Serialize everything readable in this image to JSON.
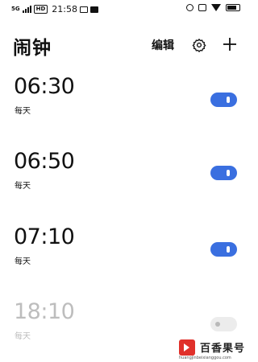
{
  "status_bar": {
    "network": "5G",
    "time": "21:58"
  },
  "header": {
    "title": "闹钟",
    "edit_label": "编辑",
    "settings_icon": "gear-icon",
    "add_icon": "plus-icon"
  },
  "alarms": [
    {
      "time": "06:30",
      "repeat": "每天",
      "enabled": true
    },
    {
      "time": "06:50",
      "repeat": "每天",
      "enabled": true
    },
    {
      "time": "07:10",
      "repeat": "每天",
      "enabled": true
    },
    {
      "time": "18:10",
      "repeat": "每天",
      "enabled": false
    }
  ],
  "watermark": {
    "title": "百香果号",
    "url": "huangjinbeixianggou.com"
  },
  "colors": {
    "toggle_on": "#3a6fe0",
    "toggle_off": "#ececec",
    "disabled_text": "#bdbdbd",
    "watermark_red": "#e0302a"
  }
}
